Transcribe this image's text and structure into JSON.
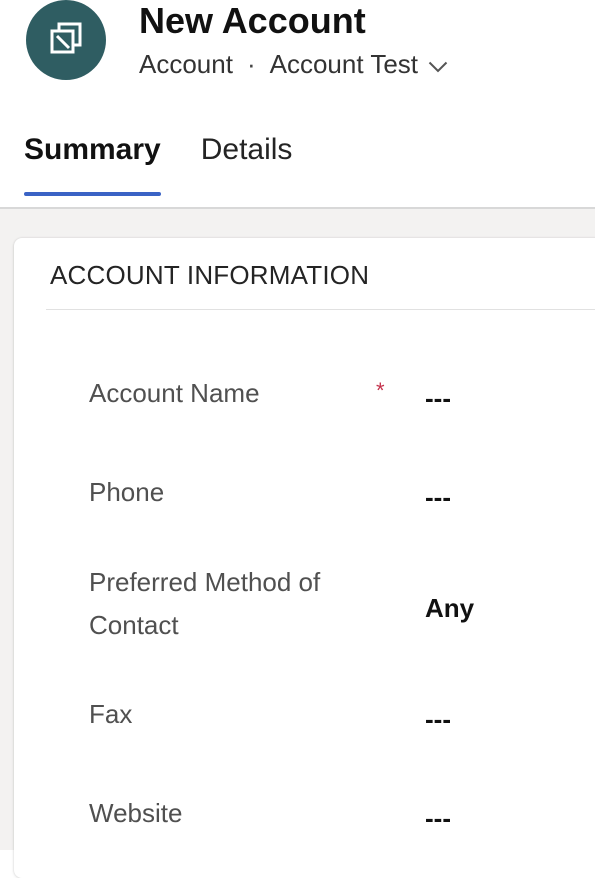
{
  "header": {
    "title": "New Account",
    "entity": "Account",
    "separator": "·",
    "form_name": "Account Test",
    "avatar_icon": "record-icon",
    "avatar_color": "#2f5d62"
  },
  "tabs": [
    {
      "label": "Summary",
      "active": true
    },
    {
      "label": "Details",
      "active": false
    }
  ],
  "section": {
    "title": "ACCOUNT INFORMATION",
    "fields": [
      {
        "label": "Account Name",
        "value": "---",
        "required": true
      },
      {
        "label": "Phone",
        "value": "---",
        "required": false
      },
      {
        "label": "Preferred Method of Contact",
        "value": "Any",
        "required": false
      },
      {
        "label": "Fax",
        "value": "---",
        "required": false
      },
      {
        "label": "Website",
        "value": "---",
        "required": false
      }
    ],
    "required_marker": "*"
  },
  "colors": {
    "accent": "#3a63c5",
    "required": "#c4314b",
    "background": "#f3f2f1"
  }
}
